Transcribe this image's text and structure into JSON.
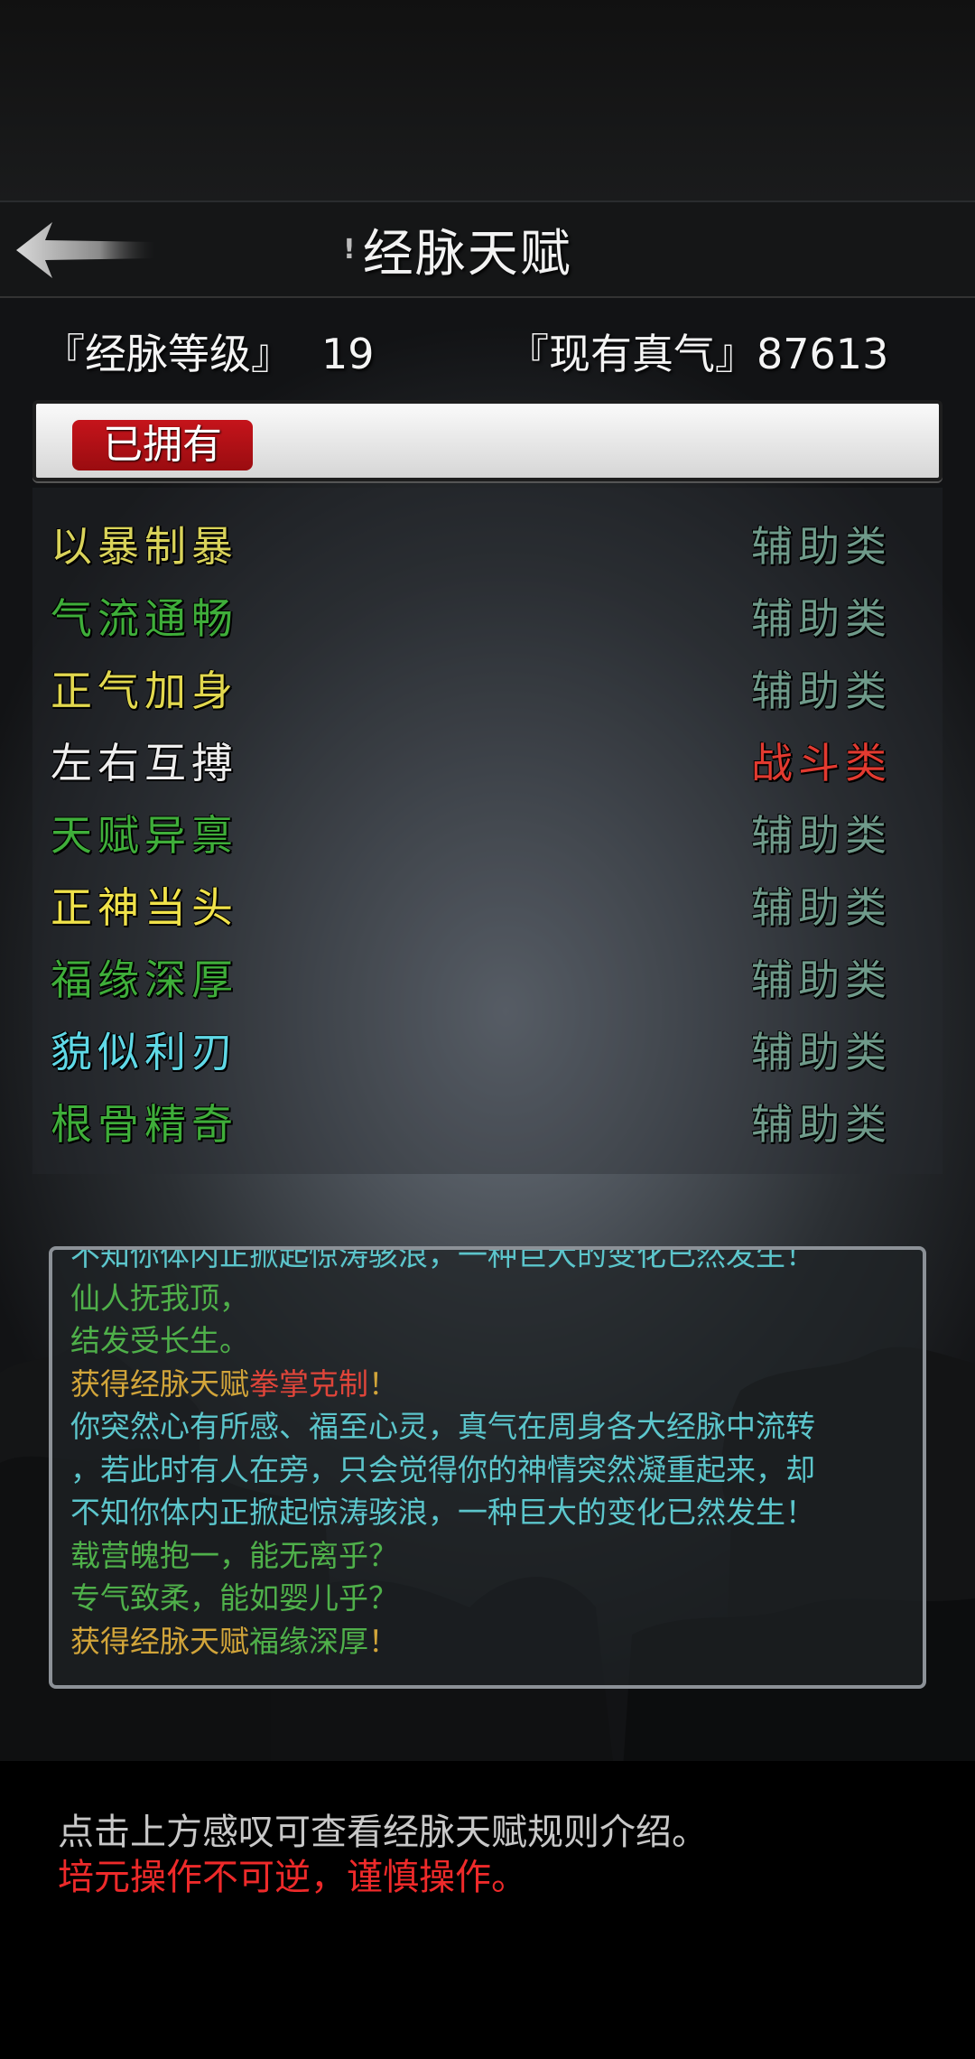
{
  "header": {
    "info_mark": "!",
    "title": "经脉天赋"
  },
  "stats": {
    "level_label": "『经脉等级』",
    "level_value": "19",
    "qi_label": "『现有真气』",
    "qi_value": "87613"
  },
  "owned_tab": "已拥有",
  "talents": [
    {
      "name": "以暴制暴",
      "type": "辅助类",
      "name_color": "#d9d35a",
      "type_color": "#6f9a8a"
    },
    {
      "name": "气流通畅",
      "type": "辅助类",
      "name_color": "#3fae3a",
      "type_color": "#6f9a8a"
    },
    {
      "name": "正气加身",
      "type": "辅助类",
      "name_color": "#e2d84e",
      "type_color": "#6f9a8a"
    },
    {
      "name": "左右互搏",
      "type": "战斗类",
      "name_color": "#eeeeee",
      "type_color": "#e23a30"
    },
    {
      "name": "天赋异禀",
      "type": "辅助类",
      "name_color": "#3fae3a",
      "type_color": "#6f9a8a"
    },
    {
      "name": "正神当头",
      "type": "辅助类",
      "name_color": "#f0e24a",
      "type_color": "#6f9a8a"
    },
    {
      "name": "福缘深厚",
      "type": "辅助类",
      "name_color": "#3fae3a",
      "type_color": "#6f9a8a"
    },
    {
      "name": "貌似利刃",
      "type": "辅助类",
      "name_color": "#5fd8e6",
      "type_color": "#6f9a8a"
    },
    {
      "name": "根骨精奇",
      "type": "辅助类",
      "name_color": "#3fae3a",
      "type_color": "#6f9a8a"
    }
  ],
  "log": [
    {
      "segments": [
        {
          "text": "不知你体内正掀起惊涛骇浪，一种巨大的变化已然发生！",
          "color": "#5cc6cc"
        }
      ]
    },
    {
      "segments": [
        {
          "text": "仙人抚我顶，",
          "color": "#4fb04a"
        }
      ]
    },
    {
      "segments": [
        {
          "text": "结发受长生。",
          "color": "#4fb04a"
        }
      ]
    },
    {
      "segments": [
        {
          "text": "获得经脉天赋",
          "color": "#d2a53a"
        },
        {
          "text": "拳掌克制",
          "color": "#e0453a"
        },
        {
          "text": "！",
          "color": "#d2a53a"
        }
      ]
    },
    {
      "segments": [
        {
          "text": "你突然心有所感、福至心灵，真气在周身各大经脉中流转",
          "color": "#5cc6cc"
        }
      ]
    },
    {
      "segments": [
        {
          "text": "，若此时有人在旁，只会觉得你的神情突然凝重起来，却",
          "color": "#5cc6cc"
        }
      ]
    },
    {
      "segments": [
        {
          "text": "不知你体内正掀起惊涛骇浪，一种巨大的变化已然发生！",
          "color": "#5cc6cc"
        }
      ]
    },
    {
      "segments": [
        {
          "text": "载营魄抱一，能无离乎？",
          "color": "#4fb04a"
        }
      ]
    },
    {
      "segments": [
        {
          "text": "专气致柔，能如婴儿乎？",
          "color": "#4fb04a"
        }
      ]
    },
    {
      "segments": [
        {
          "text": "获得经脉天赋",
          "color": "#d2a53a"
        },
        {
          "text": "福缘深厚",
          "color": "#4fb04a"
        },
        {
          "text": "！",
          "color": "#d2a53a"
        }
      ]
    }
  ],
  "footer": {
    "hint": "点击上方感叹可查看经脉天赋规则介绍。",
    "hint_color": "#c8c8c8",
    "warning": "培元操作不可逆，谨慎操作。",
    "warning_color": "#ee2a2a"
  }
}
